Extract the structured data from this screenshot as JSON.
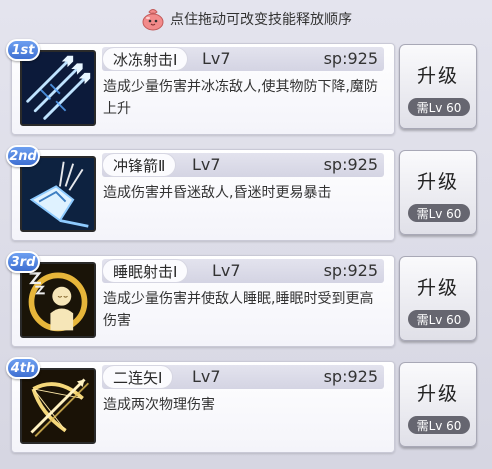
{
  "hint": {
    "text": "点住拖动可改变技能释放顺序"
  },
  "skills": [
    {
      "rank": "1st",
      "name": "冰冻射击Ⅰ",
      "level": "Lv7",
      "sp": "sp:925",
      "desc": "造成少量伤害并冰冻敌人,使其物防下降,魔防上升",
      "upgrade_label": "升级",
      "upgrade_req": "需Lv 60",
      "icon": "ice-arrows-icon"
    },
    {
      "rank": "2nd",
      "name": "冲锋箭Ⅱ",
      "level": "Lv7",
      "sp": "sp:925",
      "desc": "造成伤害并昏迷敌人,昏迷时更易暴击",
      "upgrade_label": "升级",
      "upgrade_req": "需Lv 60",
      "icon": "charge-arrow-icon"
    },
    {
      "rank": "3rd",
      "name": "睡眠射击Ⅰ",
      "level": "Lv7",
      "sp": "sp:925",
      "desc": "造成少量伤害并使敌人睡眠,睡眠时受到更高伤害",
      "upgrade_label": "升级",
      "upgrade_req": "需Lv 60",
      "icon": "sleep-icon"
    },
    {
      "rank": "4th",
      "name": "二连矢Ⅰ",
      "level": "Lv7",
      "sp": "sp:925",
      "desc": "造成两次物理伤害",
      "upgrade_label": "升级",
      "upgrade_req": "需Lv 60",
      "icon": "bow-icon"
    }
  ],
  "colors": {
    "rank_badge": "#4a7fe0",
    "card_bg": "#ffffff",
    "req_pill": "#666670"
  }
}
